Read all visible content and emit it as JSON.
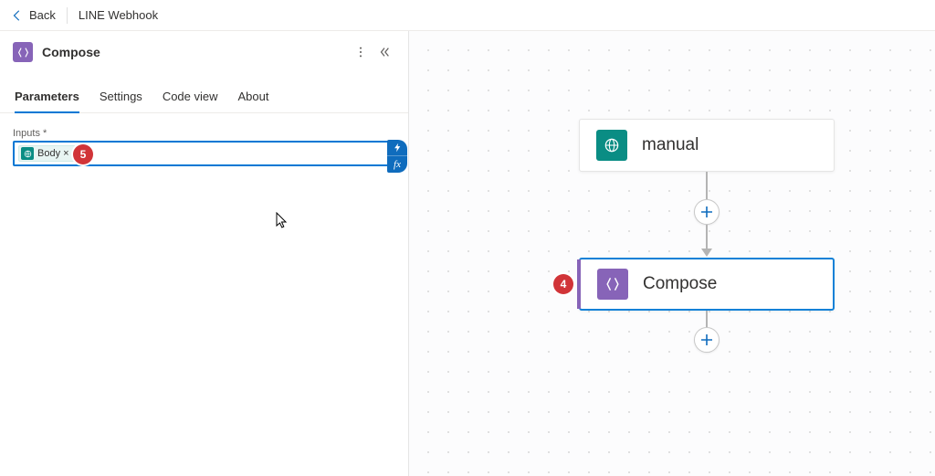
{
  "header": {
    "back_label": "Back",
    "workflow_name": "LINE Webhook"
  },
  "panel": {
    "title": "Compose",
    "tabs": [
      {
        "label": "Parameters",
        "active": true
      },
      {
        "label": "Settings",
        "active": false
      },
      {
        "label": "Code view",
        "active": false
      },
      {
        "label": "About",
        "active": false
      }
    ],
    "inputs_label": "Inputs *",
    "token_label": "Body ×",
    "marker5": "5"
  },
  "canvas": {
    "manual_label": "manual",
    "compose_label": "Compose",
    "marker4": "4"
  }
}
